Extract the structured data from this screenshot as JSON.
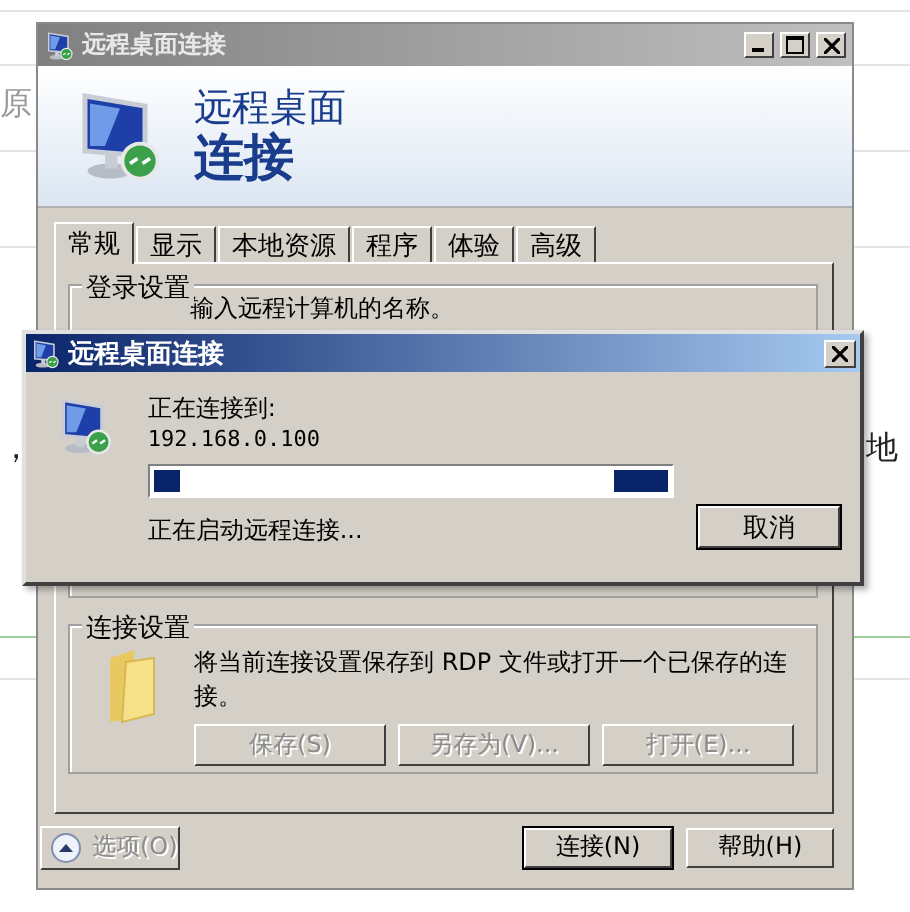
{
  "background": {
    "texts": [
      "原",
      "，",
      "地"
    ]
  },
  "window": {
    "title": "远程桌面连接",
    "header": {
      "line1": "远程桌面",
      "line2": "连接"
    },
    "tabs": [
      {
        "label": "常规",
        "selected": true
      },
      {
        "label": "显示",
        "selected": false
      },
      {
        "label": "本地资源",
        "selected": false
      },
      {
        "label": "程序",
        "selected": false
      },
      {
        "label": "体验",
        "selected": false
      },
      {
        "label": "高级",
        "selected": false
      }
    ],
    "login_group": {
      "title": "登录设置",
      "prompt": "输入远程计算机的名称。"
    },
    "connection_group": {
      "title": "连接设置",
      "text": "将当前连接设置保存到 RDP 文件或打开一个已保存的连接。",
      "buttons": [
        {
          "label": "保存(S)",
          "disabled": true
        },
        {
          "label": "另存为(V)...",
          "disabled": true
        },
        {
          "label": "打开(E)...",
          "disabled": true
        }
      ]
    },
    "options": {
      "label": "选项(O)",
      "expanded": true
    },
    "buttons": [
      {
        "label": "连接(N)",
        "default": true
      },
      {
        "label": "帮助(H)",
        "default": false
      }
    ]
  },
  "dialog": {
    "title": "远程桌面连接",
    "label": "正在连接到:",
    "address": "192.168.0.100",
    "status": "正在启动远程连接...",
    "cancel": "取消"
  }
}
